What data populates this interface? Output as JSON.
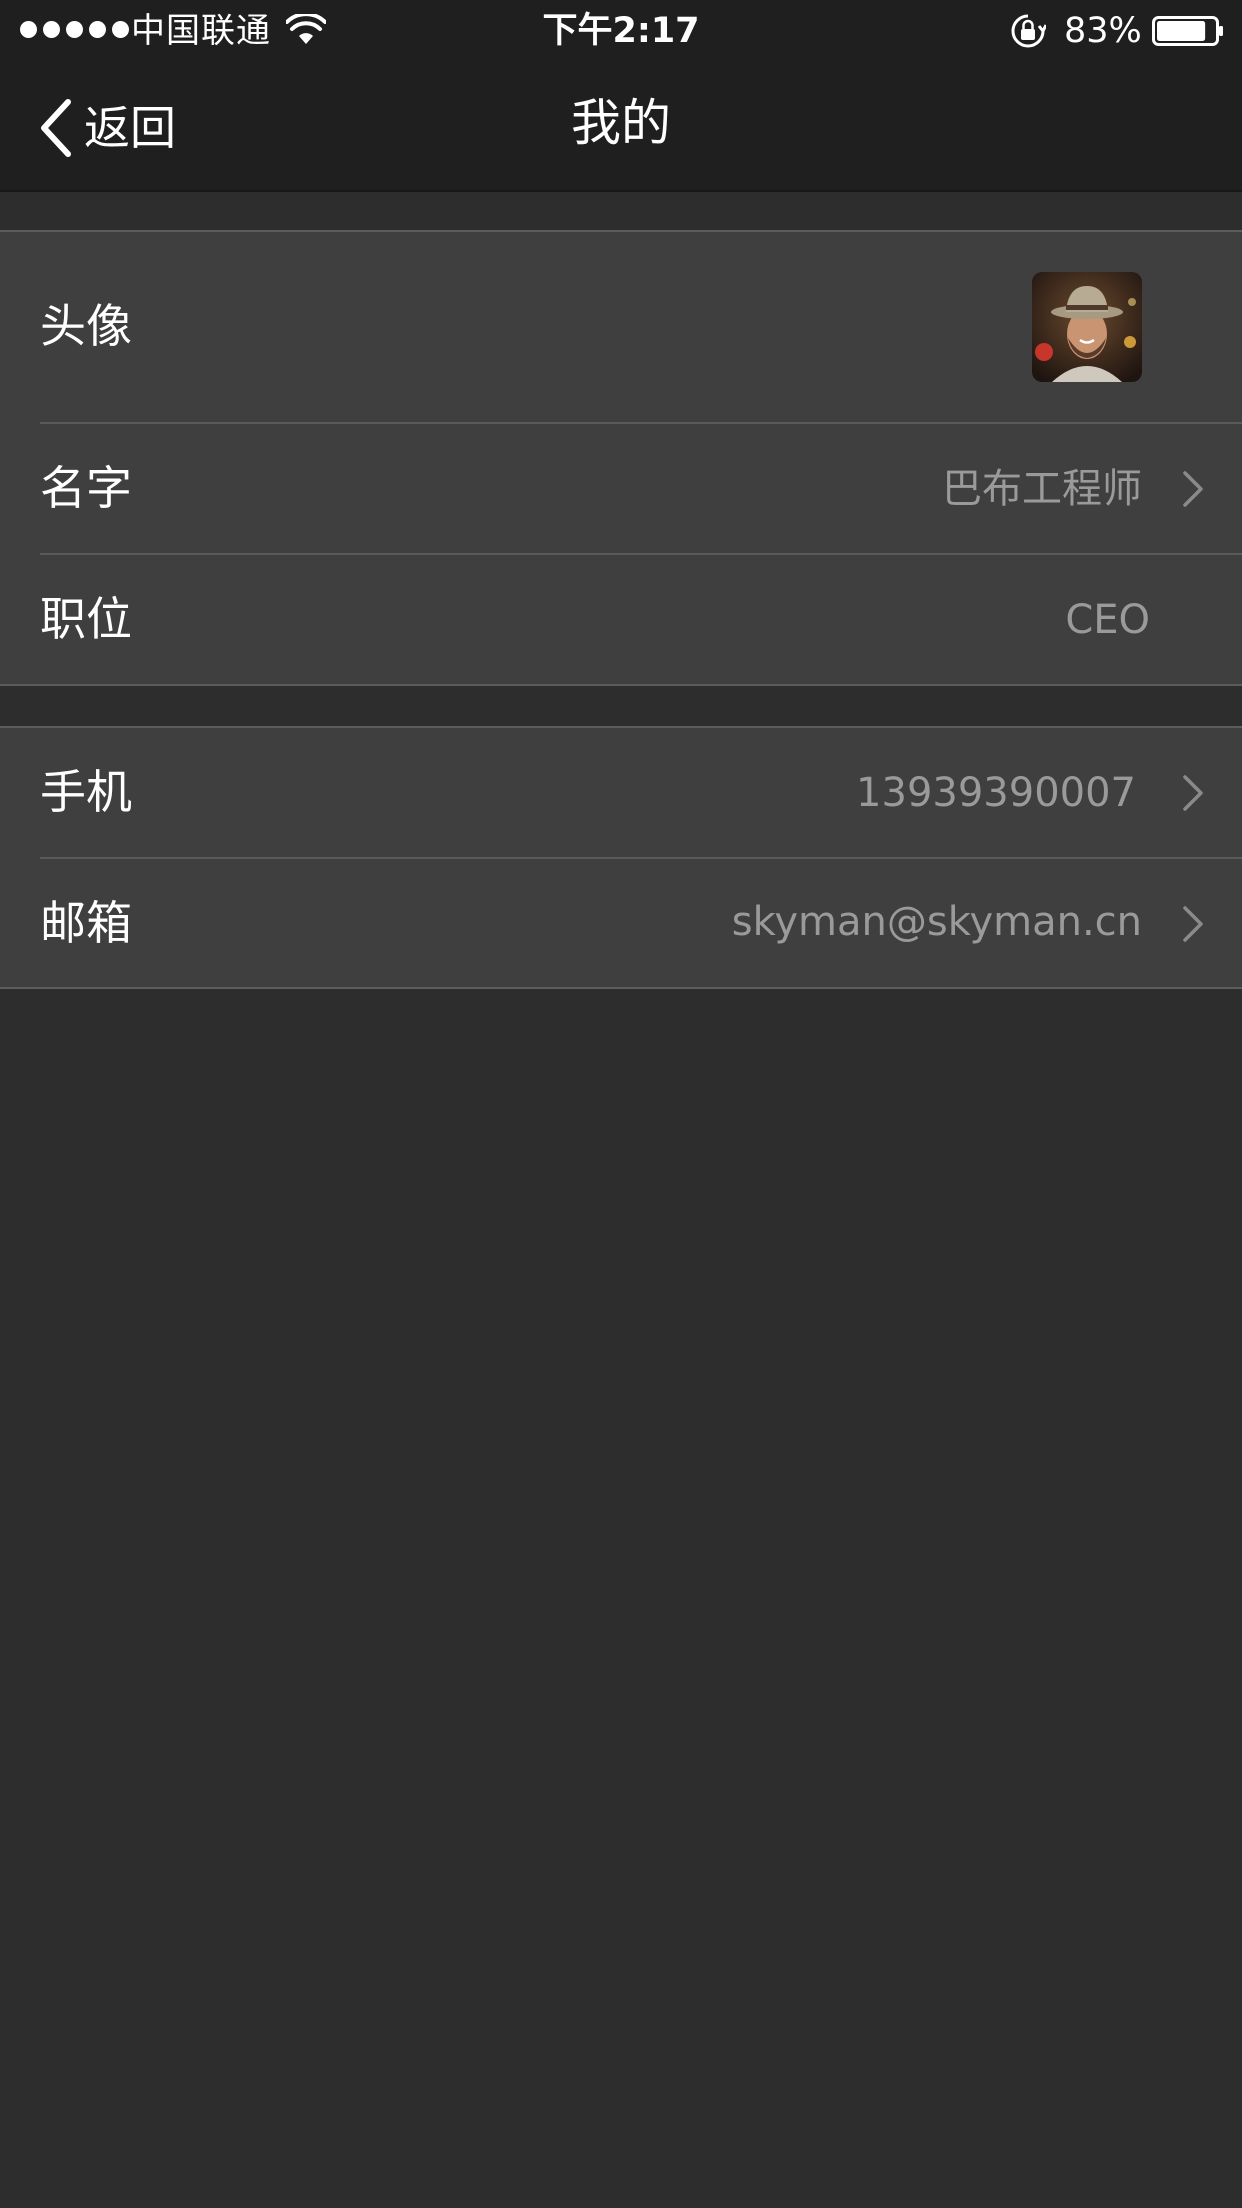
{
  "status_bar": {
    "carrier": "中国联通",
    "time": "下午2:17",
    "battery_percent": "83%",
    "battery_level": 0.83,
    "signal_bars": 5,
    "icons": [
      "signal-dots-icon",
      "wifi-icon",
      "rotation-lock-icon",
      "battery-icon"
    ]
  },
  "nav": {
    "back_label": "返回",
    "title": "我的"
  },
  "profile_group": {
    "avatar_row": {
      "label": "头像",
      "avatar_name": "avatar-photo"
    },
    "name_row": {
      "label": "名字",
      "value": "巴布工程师"
    },
    "position_row": {
      "label": "职位",
      "value": "CEO"
    }
  },
  "contact_group": {
    "phone_row": {
      "label": "手机",
      "value": "13939390007"
    },
    "email_row": {
      "label": "邮箱",
      "value": "skyman@skyman.cn"
    }
  },
  "colors": {
    "bar_background": "#1f1f1f",
    "page_background": "#2d2d2d",
    "cell_background": "#3f3f3f",
    "secondary_text": "#9a9a9a"
  }
}
